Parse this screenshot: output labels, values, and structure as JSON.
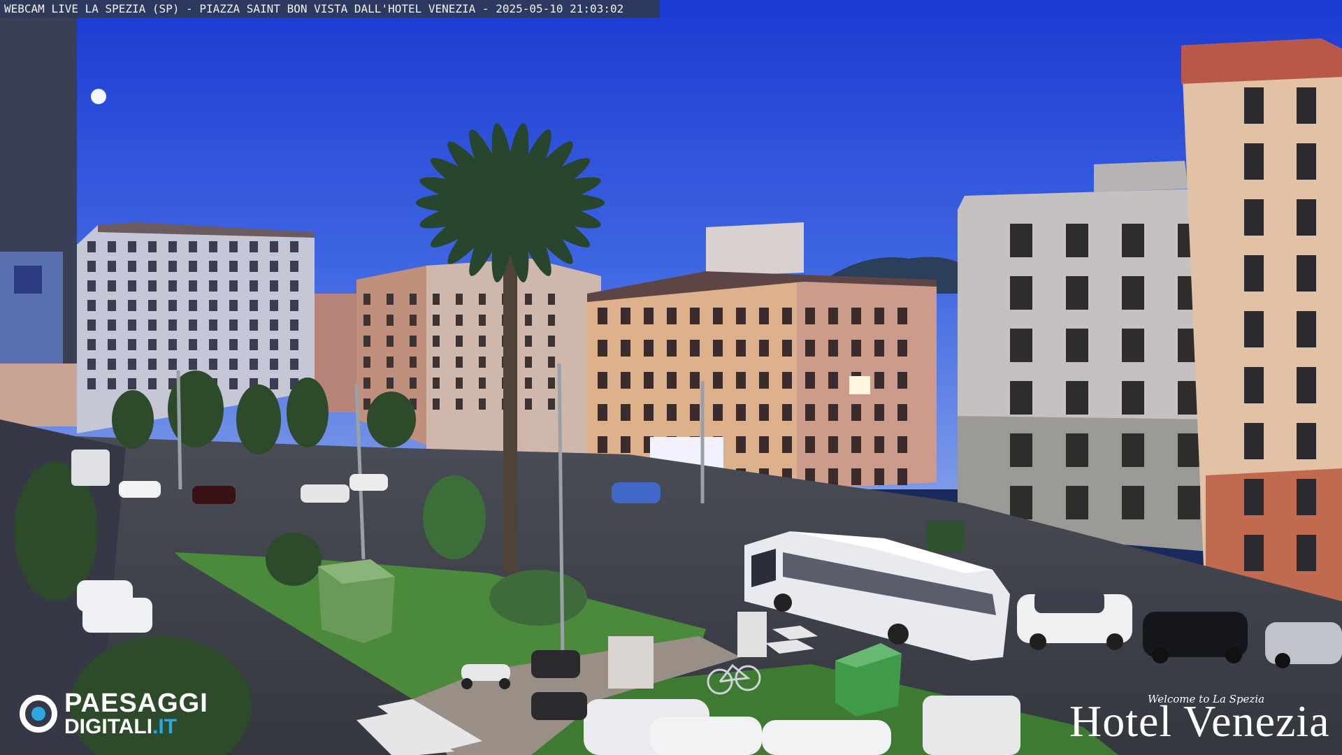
{
  "overlay": {
    "title": "WEBCAM LIVE LA SPEZIA (SP) - PIAZZA SAINT BON VISTA DALL'HOTEL VENEZIA - 2025-05-10 21:03:02"
  },
  "logos": {
    "left": {
      "line1": "PAESAGGI",
      "line2": "DIGITALI",
      "line2_suffix": ".IT",
      "accent": "#2aa9e0"
    },
    "right": {
      "tagline": "Welcome to La Spezia",
      "name": "Hotel Venezia"
    }
  },
  "colors": {
    "sky_top": "#1f3fd0",
    "sky_bottom": "#6f8fe6",
    "grass": "#4a8a3a",
    "road": "#3d4049"
  },
  "scene_icons": [
    "moon-icon",
    "palm-tree-icon",
    "bus-icon",
    "car-icon",
    "scooter-icon",
    "bicycle-icon",
    "street-lamp-icon"
  ]
}
